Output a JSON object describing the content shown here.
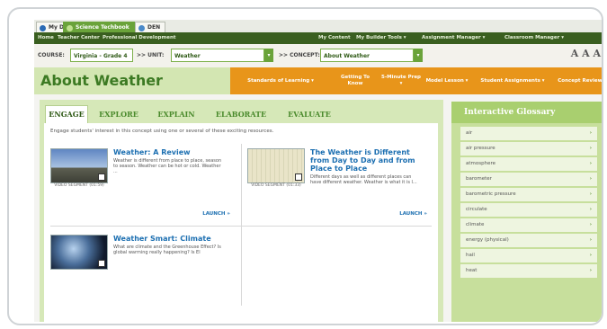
{
  "tabs": [
    {
      "label": "My DE",
      "icon": "globe-icon",
      "active": false
    },
    {
      "label": "Science Techbook",
      "icon": "leaf-icon",
      "active": true
    },
    {
      "label": "DEN",
      "icon": "people-icon",
      "active": false
    }
  ],
  "nav": {
    "left": [
      "Home",
      "Teacher Center",
      "Professional Development"
    ],
    "right": [
      "My Content",
      "My Builder Tools ▾",
      "Assignment Manager ▾",
      "Classroom Manager ▾"
    ]
  },
  "course": {
    "course_label": "COURSE:",
    "course_value": "Virginia - Grade 4",
    "unit_label": ">> UNIT:",
    "unit_value": "Weather",
    "concept_label": ">> CONCEPT:",
    "concept_value": "About Weather",
    "font_size_glyph": "A A A"
  },
  "title": "About Weather",
  "orange_menu": [
    "Standards of Learning ▾",
    "Getting To Know",
    "5-Minute Prep ▾",
    "Model Lesson ▾",
    "Student Assignments ▾",
    "Concept Review"
  ],
  "engage_tabs": [
    "ENGAGE",
    "EXPLORE",
    "EXPLAIN",
    "ELABORATE",
    "EVALUATE"
  ],
  "intro": "Engage students' interest in this concept using one or several of these exciting resources.",
  "resources": [
    {
      "title": "Weather: A Review",
      "desc": "Weather is different from place to place, season to season. Weather can be hot or cold. Weather ...",
      "video_label": "VIDEO SEGMENT (01:59)",
      "launch": "LAUNCH »"
    },
    {
      "title": "The Weather is Different from Day to Day and from Place to Place",
      "desc": "Different days as well as different places can have different weather. Weather is what it is l...",
      "video_label": "VIDEO SEGMENT (01:33)",
      "launch": "LAUNCH »"
    },
    {
      "title": "Weather Smart: Climate",
      "desc": "What are climate and the Greenhouse Effect? Is global warming really happening? Is El",
      "video_label": "",
      "launch": ""
    }
  ],
  "glossary": {
    "title": "Interactive Glossary",
    "items": [
      "air",
      "air pressure",
      "atmosphere",
      "barometer",
      "barometric pressure",
      "circulate",
      "climate",
      "energy (physical)",
      "hail",
      "heat"
    ]
  },
  "colors": {
    "green_dark": "#3a5f20",
    "green_accent": "#6aa33a",
    "orange": "#e8951a",
    "link_blue": "#1c6fb1"
  }
}
